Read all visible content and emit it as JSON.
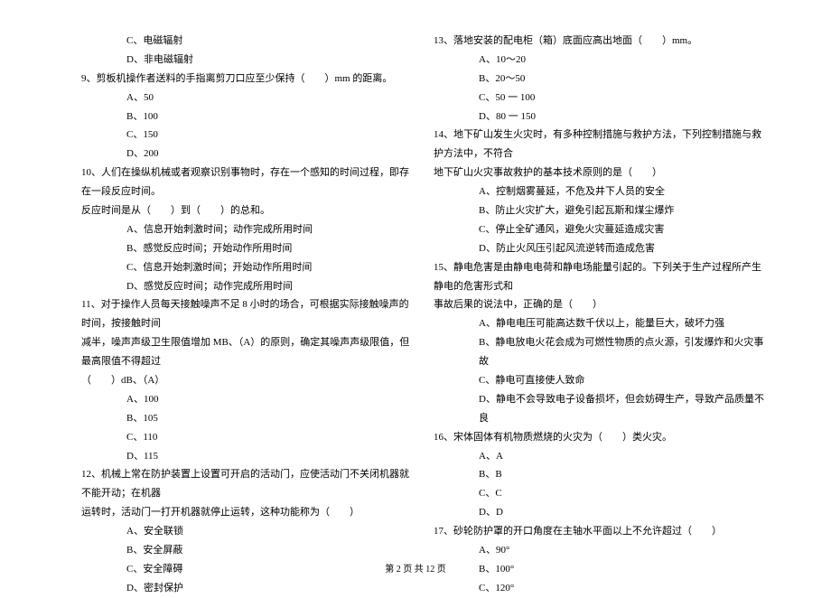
{
  "left": {
    "q8_optC": "C、电磁辐射",
    "q8_optD": "D、非电磁辐射",
    "q9": "9、剪板机操作者送料的手指离剪刀口应至少保持（　　）mm 的距离。",
    "q9_A": "A、50",
    "q9_B": "B、100",
    "q9_C": "C、150",
    "q9_D": "D、200",
    "q10_l1": "10、人们在操纵机械或者观察识别事物时，存在一个感知的时间过程，即存在一段反应时间。",
    "q10_l2": "反应时间是从（　　）到（　　）的总和。",
    "q10_A": "A、信息开始刺激时间；动作完成所用时间",
    "q10_B": "B、感觉反应时间；开始动作所用时间",
    "q10_C": "C、信息开始刺激时间；开始动作所用时间",
    "q10_D": "D、感觉反应时间；动作完成所用时间",
    "q11_l1": "11、对于操作人员每天接触噪声不足 8 小时的场合，可根据实际接触噪声的时间，按接触时间",
    "q11_l2": "减半，噪声声级卫生限值增加 MB、（A）的原则，确定其噪声声级限值，但最高限值不得超过",
    "q11_l3": "（　　）dB、（A）",
    "q11_A": "A、100",
    "q11_B": "B、105",
    "q11_C": "C、110",
    "q11_D": "D、115",
    "q12_l1": "12、机械上常在防护装置上设置可开启的活动门，应使活动门不关闭机器就不能开动；在机器",
    "q12_l2": "运转时，活动门一打开机器就停止运转，这种功能称为（　　）",
    "q12_A": "A、安全联锁",
    "q12_B": "B、安全屏蔽",
    "q12_C": "C、安全障碍",
    "q12_D": "D、密封保护"
  },
  "right": {
    "q13": "13、落地安装的配电柜（箱）底面应高出地面（　　）mm。",
    "q13_A": "A、10～20",
    "q13_B": "B、20～50",
    "q13_C": "C、50 一 100",
    "q13_D": "D、80 一 150",
    "q14_l1": "14、地下矿山发生火灾时，有多种控制措施与救护方法，下列控制措施与救护方法中，不符合",
    "q14_l2": "地下矿山火灾事故救护的基本技术原则的是（　　）",
    "q14_A": "A、控制烟雾蔓延，不危及井下人员的安全",
    "q14_B": "B、防止火灾扩大，避免引起瓦斯和煤尘爆炸",
    "q14_C": "C、停止全矿通风，避免火灾蔓延造成灾害",
    "q14_D": "D、防止火风压引起风流逆转而造成危害",
    "q15_l1": "15、静电危害是由静电电荷和静电场能量引起的。下列关于生产过程所产生静电的危害形式和",
    "q15_l2": "事故后果的说法中，正确的是（　　）",
    "q15_A": "A、静电电压可能高达数千伏以上，能量巨大，破坏力强",
    "q15_B": "B、静电放电火花会成为可燃性物质的点火源，引发爆炸和火灾事故",
    "q15_C": "C、静电可直接使人致命",
    "q15_D": "D、静电不会导致电子设备损坏，但会妨碍生产，导致产品质量不良",
    "q16": "16、宋体固体有机物质燃烧的火灾为（　　）类火灾。",
    "q16_A": "A、A",
    "q16_B": "B、B",
    "q16_C": "C、C",
    "q16_D": "D、D",
    "q17": "17、砂轮防护罩的开口角度在主轴水平面以上不允许超过（　　）",
    "q17_A": "A、90°",
    "q17_B": "B、100°",
    "q17_C": "C、120°"
  },
  "footer": "第 2 页 共 12 页"
}
